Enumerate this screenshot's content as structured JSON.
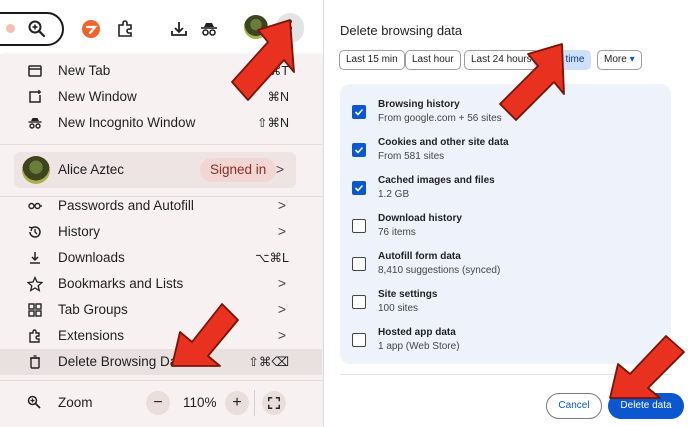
{
  "colors": {
    "accent_blue": "#0b57d0",
    "arrow_red": "#e8321f",
    "menu_bg": "#f7f2f1",
    "panel_bg": "#eef3fb"
  },
  "menu": {
    "items_top": [
      {
        "icon": "new-tab-icon",
        "label": "New Tab",
        "shortcut": "⌘T"
      },
      {
        "icon": "new-window-icon",
        "label": "New Window",
        "shortcut": "⌘N"
      },
      {
        "icon": "incognito-icon",
        "label": "New Incognito Window",
        "shortcut": "⇧⌘N"
      }
    ],
    "profile": {
      "name": "Alice Aztec",
      "badge": "Signed in",
      "chevron": ">"
    },
    "items_bottom": [
      {
        "icon": "key-icon",
        "label": "Passwords and Autofill",
        "shortcut": ">"
      },
      {
        "icon": "history-icon",
        "label": "History",
        "shortcut": ">"
      },
      {
        "icon": "download-icon",
        "label": "Downloads",
        "shortcut": "⌥⌘L"
      },
      {
        "icon": "star-icon",
        "label": "Bookmarks and Lists",
        "shortcut": ">"
      },
      {
        "icon": "tab-groups-icon",
        "label": "Tab Groups",
        "shortcut": ">"
      },
      {
        "icon": "extensions-icon",
        "label": "Extensions",
        "shortcut": ">"
      },
      {
        "icon": "trash-icon",
        "label": "Delete Browsing Data...",
        "shortcut": "⇧⌘⌫"
      }
    ],
    "zoom": {
      "label": "Zoom",
      "minus": "−",
      "value": "110%",
      "plus": "+"
    }
  },
  "dialog": {
    "title": "Delete browsing data",
    "time_ranges": [
      "Last 15 min",
      "Last hour",
      "Last 24 hours",
      "All time",
      "More"
    ],
    "selected_range": "All time",
    "more_caret": "▾",
    "options": [
      {
        "title": "Browsing history",
        "subtitle": "From google.com + 56 sites",
        "checked": true
      },
      {
        "title": "Cookies and other site data",
        "subtitle": "From 581 sites",
        "checked": true
      },
      {
        "title": "Cached images and files",
        "subtitle": "1.2 GB",
        "checked": true
      },
      {
        "title": "Download history",
        "subtitle": "76 items",
        "checked": false
      },
      {
        "title": "Autofill form data",
        "subtitle": "8,410 suggestions (synced)",
        "checked": false
      },
      {
        "title": "Site settings",
        "subtitle": "100 sites",
        "checked": false
      },
      {
        "title": "Hosted app data",
        "subtitle": "1 app (Web Store)",
        "checked": false
      }
    ],
    "cancel_label": "Cancel",
    "delete_label": "Delete data"
  }
}
